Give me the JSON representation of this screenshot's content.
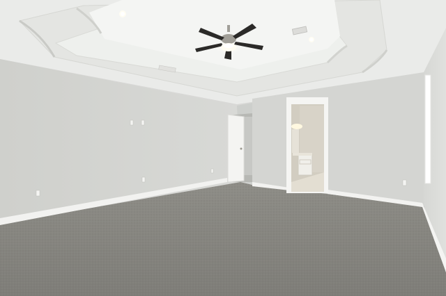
{
  "scene": {
    "description_tags": [
      "empty-bedroom",
      "tray-ceiling",
      "ceiling-fan",
      "carpet-floor",
      "open-doorway",
      "en-suite-bathroom"
    ],
    "colors": {
      "ceiling": "#ecedeb",
      "tray_inner": "#f3f4f2",
      "wall_left": "#d3d4d1",
      "wall_back": "#cfd1ce",
      "wall_right": "#d9dad7",
      "carpet": "#85847f",
      "baseboard": "#f2f2f0",
      "door": "#f4f4f2",
      "fan_blade": "#2b2a28",
      "fan_metal": "#a19f98",
      "light_glow": "#fffdf2",
      "bath_wall": "#d4cfc3",
      "bath_floor": "#e2ddd1"
    },
    "icons": [
      "ceiling-fan-icon",
      "recessed-light-icon",
      "air-vent-icon",
      "light-switch-icon",
      "outlet-icon"
    ]
  }
}
